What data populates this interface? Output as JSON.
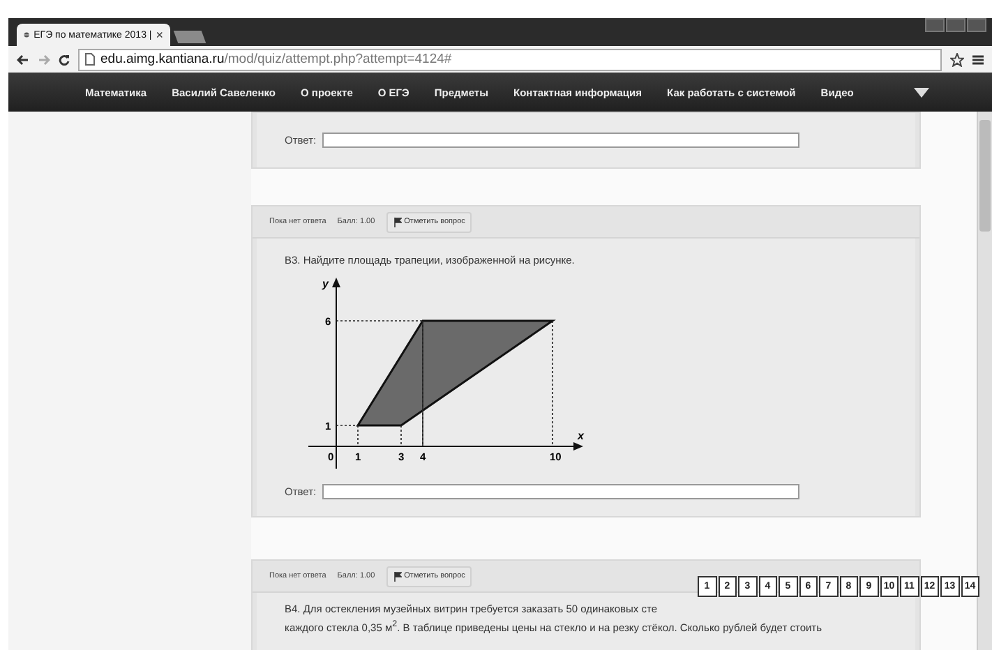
{
  "browser": {
    "tab": {
      "title": "ЕГЭ по математике 2013 |",
      "close": "×"
    },
    "url_host": "edu.aimg.kantiana.ru",
    "url_path": "/mod/quiz/attempt.php?attempt=4124#"
  },
  "nav": {
    "items": [
      "Математика",
      "Василий Савеленко",
      "О проекте",
      "О ЕГЭ",
      "Предметы",
      "Контактная информация",
      "Как работать с системой",
      "Видео"
    ]
  },
  "previous_question": {
    "answer_label": "Ответ:"
  },
  "questions": [
    {
      "kind": "figure",
      "status": "Пока нет ответа",
      "score": "Балл: 1.00",
      "flag_button": "Отметить вопрос",
      "text": "В3. Найдите площадь трапеции, изображенной на рисунке.",
      "figure": {
        "x_axis": "x",
        "y_axis": "y",
        "x_ticks": [
          "0",
          "1",
          "3",
          "4",
          "10"
        ],
        "y_ticks": [
          "6",
          "1"
        ]
      },
      "answer_label": "Ответ:"
    },
    {
      "kind": "text",
      "status": "Пока нет ответа",
      "score": "Балл: 1.00",
      "flag_button": "Отметить вопрос",
      "lines": [
        "В4. Для остекления музейных витрин требуется заказать 50 одинаковых сте",
        "каждого стекла 0,35 м$^{2}$. В таблице приведены цены на стекло и на резку стёкол. Сколько рублей будет стоить"
      ]
    }
  ],
  "quiz_navigation": [
    "1",
    "2",
    "3",
    "4",
    "5",
    "6",
    "7",
    "8",
    "9",
    "10",
    "11",
    "12",
    "13",
    "14"
  ]
}
